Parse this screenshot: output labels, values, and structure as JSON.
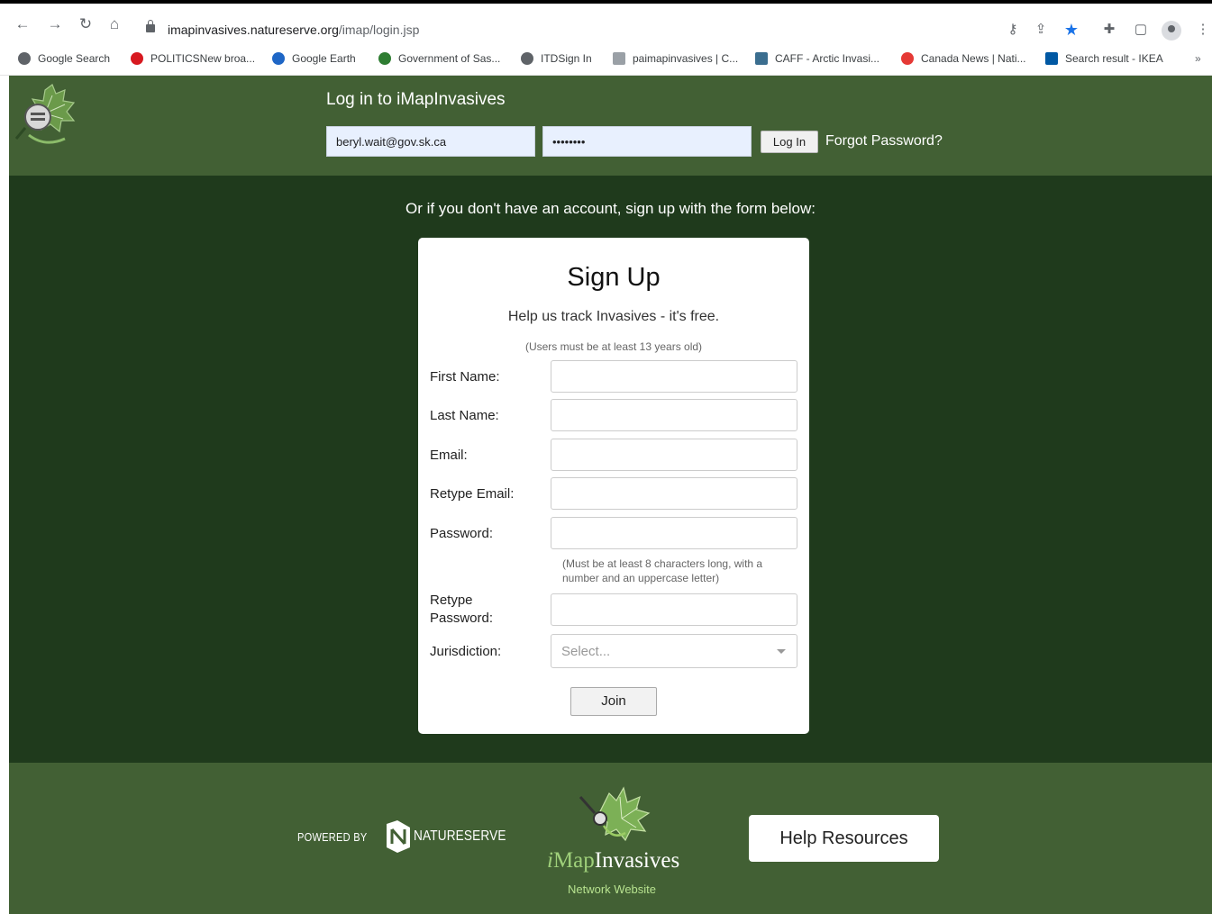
{
  "browser": {
    "url_domain": "imapinvasives.natureserve.org",
    "url_path": "/imap/login.jsp",
    "bookmarks": [
      {
        "label": "Google Search"
      },
      {
        "label": "POLITICSNew broa..."
      },
      {
        "label": "Google Earth"
      },
      {
        "label": "Government of Sas..."
      },
      {
        "label": "ITDSign In"
      },
      {
        "label": "paimapinvasives | C..."
      },
      {
        "label": "CAFF - Arctic Invasi..."
      },
      {
        "label": "Canada News | Nati..."
      },
      {
        "label": "Search result - IKEA"
      }
    ],
    "more_bookmarks": "»",
    "accent_color": "#1a73e8"
  },
  "header": {
    "title": "Log in to iMapInvasives",
    "email_value": "beryl.wait@gov.sk.ca",
    "password_masked": "••••••••",
    "login_button": "Log In",
    "forgot_link": "Forgot Password?",
    "bg_color": "#426034"
  },
  "signup_prompt": "Or if you don't have an account, sign up with the form below:",
  "signup": {
    "title": "Sign Up",
    "subtitle": "Help us track Invasives - it's free.",
    "age_note": "(Users must be at least 13 years old)",
    "fields": {
      "first_name": "First Name:",
      "last_name": "Last Name:",
      "email": "Email:",
      "retype_email": "Retype Email:",
      "password": "Password:",
      "retype_password_1": "Retype",
      "retype_password_2": "Password:",
      "jurisdiction": "Jurisdiction:"
    },
    "password_note": "(Must be at least 8 characters long, with a number and an uppercase letter)",
    "jurisdiction_placeholder": "Select...",
    "join_button": "Join"
  },
  "footer": {
    "powered_by": "POWERED BY",
    "natureserve": "NATURESERVE",
    "brand_i": "i",
    "brand_map": "Map",
    "brand_invasives": "Invasives",
    "network_website": "Network Website",
    "help_button": "Help Resources"
  }
}
